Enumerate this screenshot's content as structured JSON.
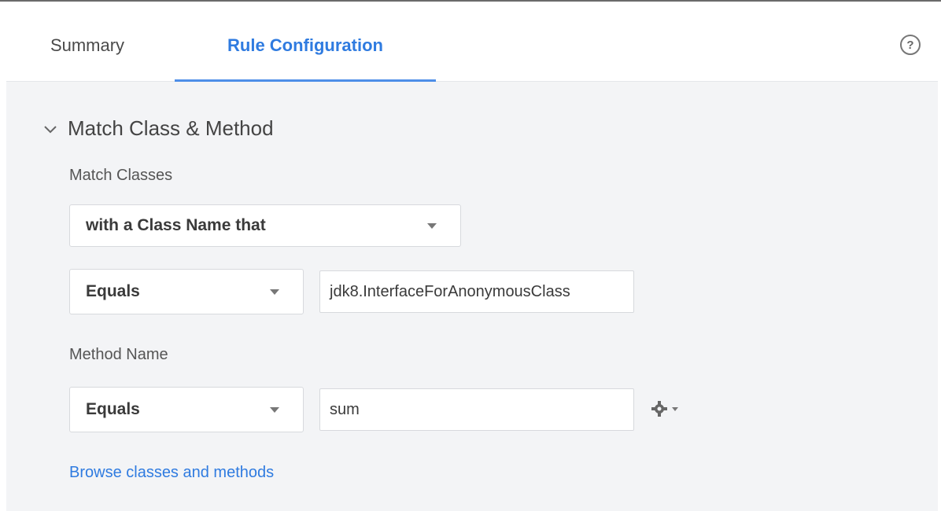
{
  "tabs": {
    "summary": "Summary",
    "rule_configuration": "Rule Configuration",
    "active": "Rule Configuration"
  },
  "help": {
    "glyph": "?",
    "icon": "help-circle-icon"
  },
  "section": {
    "title": "Match Class & Method",
    "expanded": true,
    "match_classes_label": "Match Classes",
    "class_selector": "with a Class Name that",
    "class_operator": "Equals",
    "class_value": "jdk8.InterfaceForAnonymousClass",
    "method_name_label": "Method Name",
    "method_operator": "Equals",
    "method_value": "sum",
    "browse_link": "Browse classes and methods"
  },
  "colors": {
    "accent": "#2f7be0",
    "underline": "#4d8ee8",
    "panel_bg": "#f3f4f6"
  }
}
